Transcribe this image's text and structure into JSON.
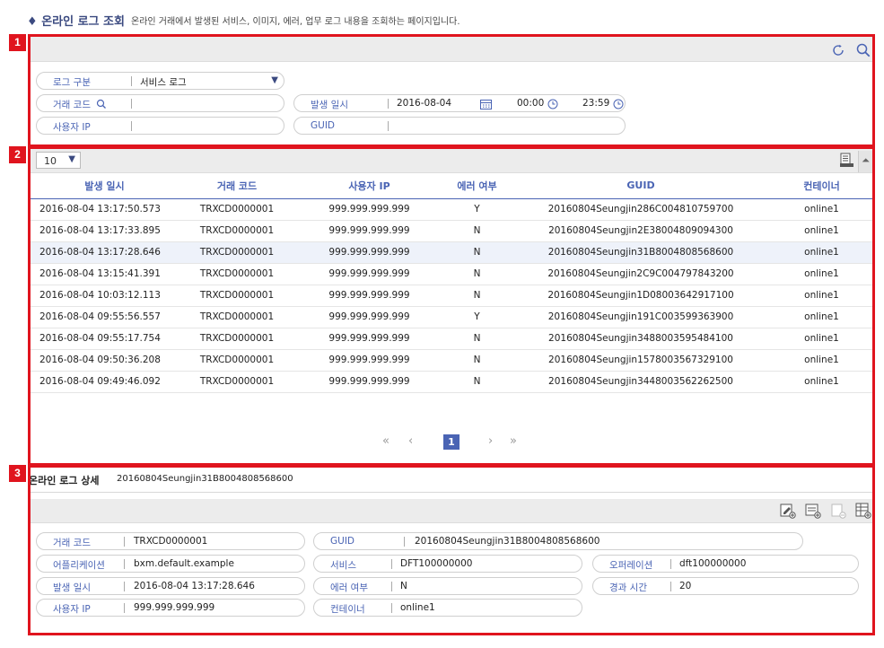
{
  "page": {
    "title": "온라인 로그 조회",
    "description": "온라인 거래에서 발생된 서비스, 이미지, 에러, 업무 로그 내용을 조회하는 페이지입니다."
  },
  "badges": [
    "1",
    "2",
    "3"
  ],
  "search": {
    "log_type_label": "로그 구분",
    "log_type_value": "서비스 로그",
    "trx_code_label": "거래 코드",
    "trx_code_value": "",
    "date_label": "발생 일시",
    "date_value": "2016-08-04",
    "time_from": "00:00",
    "time_to": "23:59",
    "user_ip_label": "사용자 IP",
    "user_ip_value": "",
    "guid_label": "GUID",
    "guid_value": ""
  },
  "grid": {
    "page_size": "10",
    "columns": [
      "발생 일시",
      "거래 코드",
      "사용자 IP",
      "에러 여부",
      "GUID",
      "컨테이너"
    ],
    "rows": [
      [
        "2016-08-04 13:17:50.573",
        "TRXCD0000001",
        "999.999.999.999",
        "Y",
        "20160804Seungjin286C004810759700",
        "online1"
      ],
      [
        "2016-08-04 13:17:33.895",
        "TRXCD0000001",
        "999.999.999.999",
        "N",
        "20160804Seungjin2E38004809094300",
        "online1"
      ],
      [
        "2016-08-04 13:17:28.646",
        "TRXCD0000001",
        "999.999.999.999",
        "N",
        "20160804Seungjin31B8004808568600",
        "online1"
      ],
      [
        "2016-08-04 13:15:41.391",
        "TRXCD0000001",
        "999.999.999.999",
        "N",
        "20160804Seungjin2C9C004797843200",
        "online1"
      ],
      [
        "2016-08-04 10:03:12.113",
        "TRXCD0000001",
        "999.999.999.999",
        "N",
        "20160804Seungjin1D08003642917100",
        "online1"
      ],
      [
        "2016-08-04 09:55:56.557",
        "TRXCD0000001",
        "999.999.999.999",
        "Y",
        "20160804Seungjin191C003599363900",
        "online1"
      ],
      [
        "2016-08-04 09:55:17.754",
        "TRXCD0000001",
        "999.999.999.999",
        "N",
        "20160804Seungjin3488003595484100",
        "online1"
      ],
      [
        "2016-08-04 09:50:36.208",
        "TRXCD0000001",
        "999.999.999.999",
        "N",
        "20160804Seungjin1578003567329100",
        "online1"
      ],
      [
        "2016-08-04 09:49:46.092",
        "TRXCD0000001",
        "999.999.999.999",
        "N",
        "20160804Seungjin3448003562262500",
        "online1"
      ]
    ],
    "selected_row": 2,
    "pagination": {
      "first": "«",
      "prev": "‹",
      "current": "1",
      "next": "›",
      "last": "»"
    }
  },
  "detail": {
    "title": "온라인 로그 상세",
    "guid_header": "20160804Seungjin31B8004808568600",
    "trx_code_label": "거래 코드",
    "trx_code_value": "TRXCD0000001",
    "guid_label": "GUID",
    "guid_value": "20160804Seungjin31B8004808568600",
    "app_label": "어플리케이션",
    "app_value": "bxm.default.example",
    "service_label": "서비스",
    "service_value": "DFT100000000",
    "operation_label": "오퍼레이션",
    "operation_value": "dft100000000",
    "date_label": "발생 일시",
    "date_value": "2016-08-04 13:17:28.646",
    "error_label": "에러 여부",
    "error_value": "N",
    "elapsed_label": "경과 시간",
    "elapsed_value": "20",
    "user_ip_label": "사용자 IP",
    "user_ip_value": "999.999.999.999",
    "container_label": "컨테이너",
    "container_value": "online1"
  },
  "colors": {
    "accent": "#4a64b4",
    "highlight": "#e0141e"
  },
  "icons": [
    "refresh-icon",
    "search-icon",
    "calendar-icon",
    "clock-icon",
    "excel-download-icon",
    "collapse-up-icon",
    "detail-action-icon"
  ]
}
